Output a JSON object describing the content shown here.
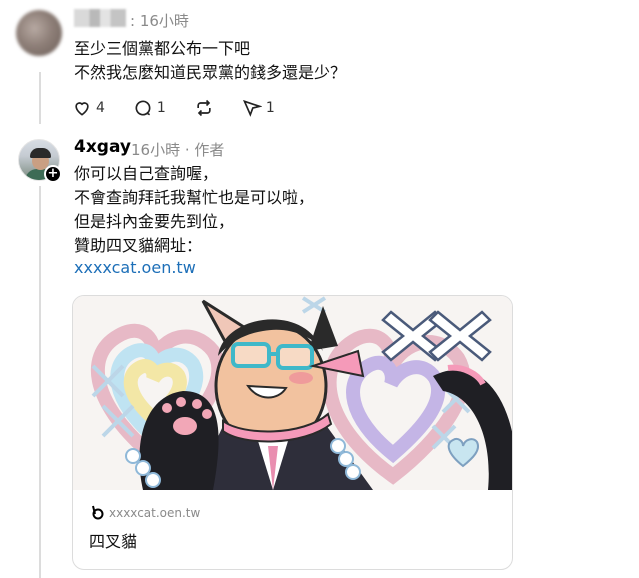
{
  "post1": {
    "time": "16小時",
    "lines": [
      "至少三個黨都公布一下吧",
      "不然我怎麼知道民眾黨的錢多還是少？"
    ],
    "actions": {
      "likes": "4",
      "replies": "1",
      "reposts": "",
      "shares": "1"
    }
  },
  "post2": {
    "author": "4xgay",
    "time_meta": "16小時 · 作者",
    "lines": [
      "你可以自己查詢喔，",
      "不會查詢拜託我幫忙也是可以啦，",
      "但是抖內金要先到位，",
      "贊助四叉貓網址："
    ],
    "link": "xxxxcat.oen.tw",
    "card": {
      "domain": "xxxxcat.oen.tw",
      "title": "四叉貓"
    }
  },
  "colors": {
    "link": "#1d6fb8",
    "muted": "#8a8a8a",
    "border": "#dcdcdc"
  },
  "icons": [
    "heart-icon",
    "comment-icon",
    "repost-icon",
    "share-icon",
    "follow-plus-icon",
    "site-favicon-icon"
  ]
}
